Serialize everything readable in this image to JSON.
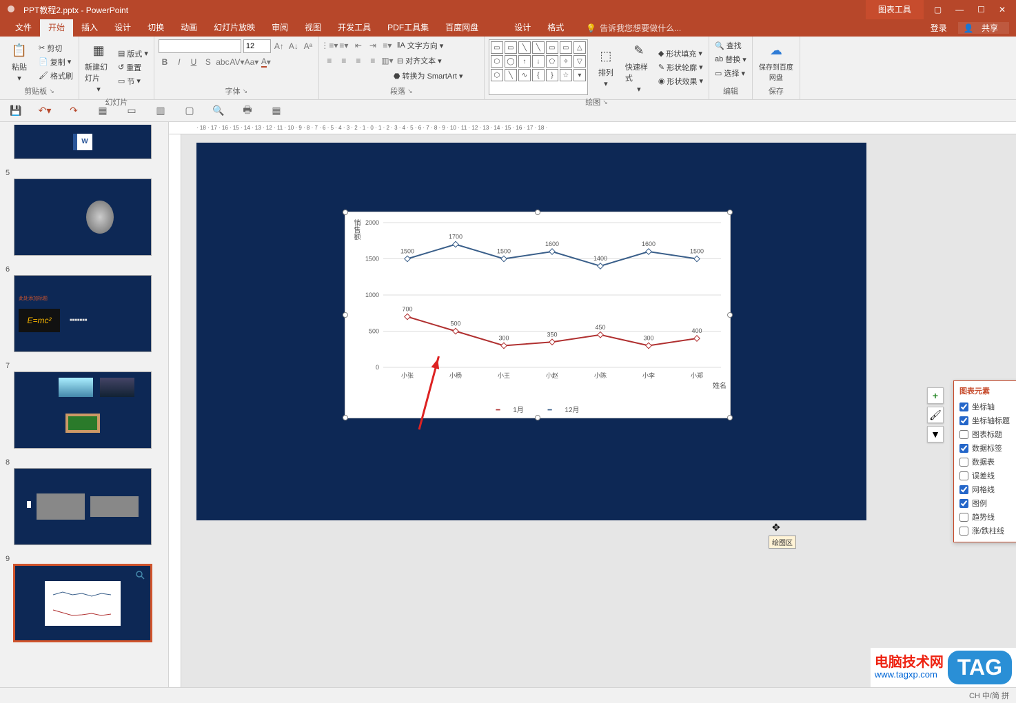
{
  "window": {
    "filename": "PPT教程2.pptx - PowerPoint",
    "context_tab": "图表工具",
    "login": "登录",
    "share": "共享",
    "win_help": "?"
  },
  "tabs": {
    "items": [
      "文件",
      "开始",
      "插入",
      "设计",
      "切换",
      "动画",
      "幻灯片放映",
      "审阅",
      "视图",
      "开发工具",
      "PDF工具集",
      "百度网盘"
    ],
    "context_items": [
      "设计",
      "格式"
    ],
    "active": "开始",
    "tellme_icon": "💡",
    "tellme": "告诉我您想要做什么..."
  },
  "ribbon": {
    "clipboard": {
      "paste": "粘贴",
      "cut": "剪切",
      "copy": "复制",
      "format_painter": "格式刷",
      "label": "剪贴板"
    },
    "slides": {
      "new": "新建幻灯片",
      "layout": "版式",
      "reset": "重置",
      "section": "节",
      "label": "幻灯片"
    },
    "font": {
      "size": "12",
      "grow": "A",
      "shrink": "A",
      "clear": "Aa",
      "label": "字体"
    },
    "para": {
      "textdir": "文字方向",
      "align": "对齐文本",
      "smartart": "转换为 SmartArt",
      "label": "段落"
    },
    "draw": {
      "arrange": "排列",
      "quick": "快速样式",
      "fill": "形状填充",
      "outline": "形状轮廓",
      "effects": "形状效果",
      "label": "绘图"
    },
    "edit": {
      "find": "查找",
      "replace": "替换",
      "select": "选择",
      "label": "编辑"
    },
    "save": {
      "btn": "保存到百度网盘",
      "label": "保存"
    }
  },
  "thumbs": [
    {
      "num": "5"
    },
    {
      "num": "6"
    },
    {
      "num": "7"
    },
    {
      "num": "8"
    },
    {
      "num": "9"
    }
  ],
  "tooltip": "绘图区",
  "chart_data": {
    "type": "line",
    "categories": [
      "小张",
      "小杨",
      "小王",
      "小赵",
      "小陈",
      "小李",
      "小郑"
    ],
    "series": [
      {
        "name": "1月",
        "color": "#b03030",
        "values": [
          700,
          500,
          300,
          350,
          450,
          300,
          400
        ]
      },
      {
        "name": "12月",
        "color": "#3a5f8a",
        "values": [
          1500,
          1700,
          1500,
          1600,
          1400,
          1600,
          1500
        ]
      }
    ],
    "ylabel": "销售额",
    "xlabel": "姓名",
    "ylim": [
      0,
      2000
    ],
    "yticks": [
      0,
      500,
      1000,
      1500,
      2000
    ]
  },
  "chart_tools": [
    {
      "icon": "+",
      "name": "add-element"
    },
    {
      "icon": "🖌",
      "name": "style"
    },
    {
      "icon": "▼",
      "name": "filter"
    }
  ],
  "elements_panel": {
    "title": "图表元素",
    "items": [
      {
        "label": "坐标轴",
        "checked": true
      },
      {
        "label": "坐标轴标题",
        "checked": true
      },
      {
        "label": "图表标题",
        "checked": false
      },
      {
        "label": "数据标签",
        "checked": true
      },
      {
        "label": "数据表",
        "checked": false
      },
      {
        "label": "误差线",
        "checked": false
      },
      {
        "label": "网格线",
        "checked": true
      },
      {
        "label": "图例",
        "checked": true
      },
      {
        "label": "趋势线",
        "checked": false
      },
      {
        "label": "涨/跌柱线",
        "checked": false
      }
    ]
  },
  "watermark": {
    "text": "电脑技术网",
    "url": "www.tagxp.com",
    "tag": "TAG"
  },
  "status": {
    "ime": "CH 中/简 拼"
  }
}
